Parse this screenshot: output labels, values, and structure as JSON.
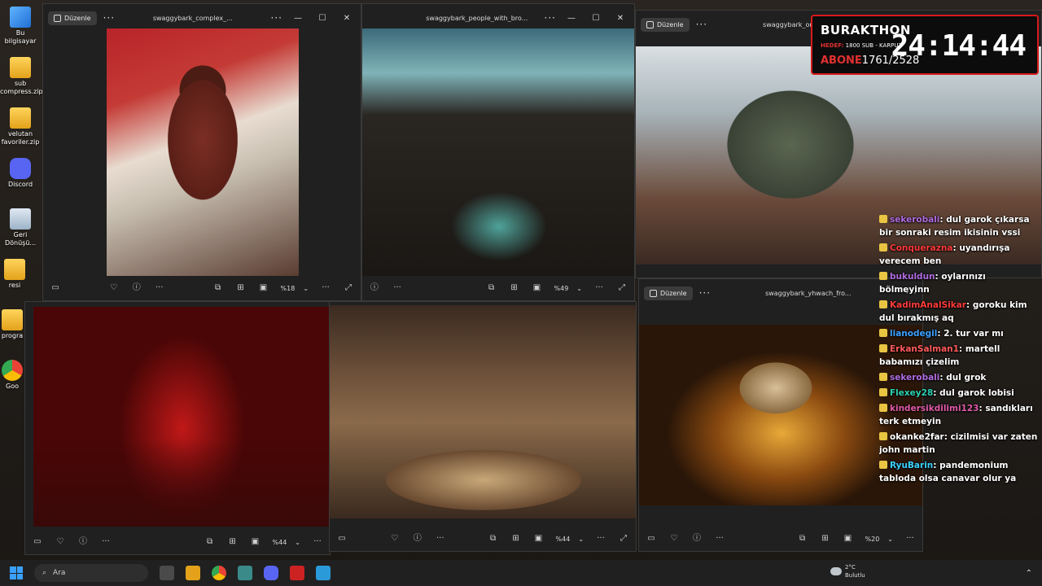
{
  "desktop": {
    "icons": [
      {
        "label": "Bu bilgisayar"
      },
      {
        "label": "sub compress.zip"
      },
      {
        "label": "velutan favoriler.zip"
      },
      {
        "label": "Discord"
      },
      {
        "label": "Geri Dönüşü..."
      },
      {
        "label": "resi"
      },
      {
        "label": "progra"
      },
      {
        "label": "Goo"
      }
    ]
  },
  "windows": [
    {
      "title": "swaggybark_complex_...",
      "edit_label": "Düzenle",
      "zoom": "%18"
    },
    {
      "title": "swaggybark_people_with_bro...",
      "zoom": "%49"
    },
    {
      "title": "swaggybark_orcs_...",
      "edit_label": "Düzenle"
    },
    {
      "title": "swaggybark_yhwach_fro...",
      "edit_label": "Düzenle",
      "zoom": "%20"
    },
    {
      "zoom": "%44"
    },
    {
      "zoom": "%44"
    }
  ],
  "overlay": {
    "title": "BURAKTHON",
    "goal_label": "HEDEF:",
    "goal_text": "1800 SUB - KARPUZ",
    "subs_label": "ABONE",
    "subs_value": "1761/2528",
    "timer": "24:14:44"
  },
  "chat": [
    {
      "user": "sekerobali",
      "color": "#b06ce0",
      "text": "dul garok çıkarsa bir sonraki resim ikisinin vssi"
    },
    {
      "user": "Conquerazna",
      "color": "#ff3a3a",
      "text": "uyandırışa verecem ben"
    },
    {
      "user": "bukuldun",
      "color": "#b06ce0",
      "text": "oylarınızı bölmeyinn"
    },
    {
      "user": "KadimAnalSikar",
      "color": "#ff3a3a",
      "text": "goroku kim dul bırakmış aq"
    },
    {
      "user": "lianodegil",
      "color": "#3aa0ff",
      "text": "2. tur var mı"
    },
    {
      "user": "ErkanSalman1",
      "color": "#ff5a5a",
      "text": "martell babamızı çizelim"
    },
    {
      "user": "sekerobali",
      "color": "#b06ce0",
      "text": "dul grok"
    },
    {
      "user": "Flexey28",
      "color": "#2ad1b0",
      "text": "dul garok lobisi"
    },
    {
      "user": "kindersikdilimi123",
      "color": "#e05aa8",
      "text": "sandıkları terk etmeyin"
    },
    {
      "user": "okanke2far",
      "color": "#ffffff",
      "text": "cizilmisi var zaten john martin"
    },
    {
      "user": "RyuBarin",
      "color": "#3ad1ff",
      "text": "pandemonium tabloda olsa canavar olur ya"
    }
  ],
  "taskbar": {
    "search_placeholder": "Ara",
    "weather_temp": "2°C",
    "weather_desc": "Bulutlu"
  }
}
